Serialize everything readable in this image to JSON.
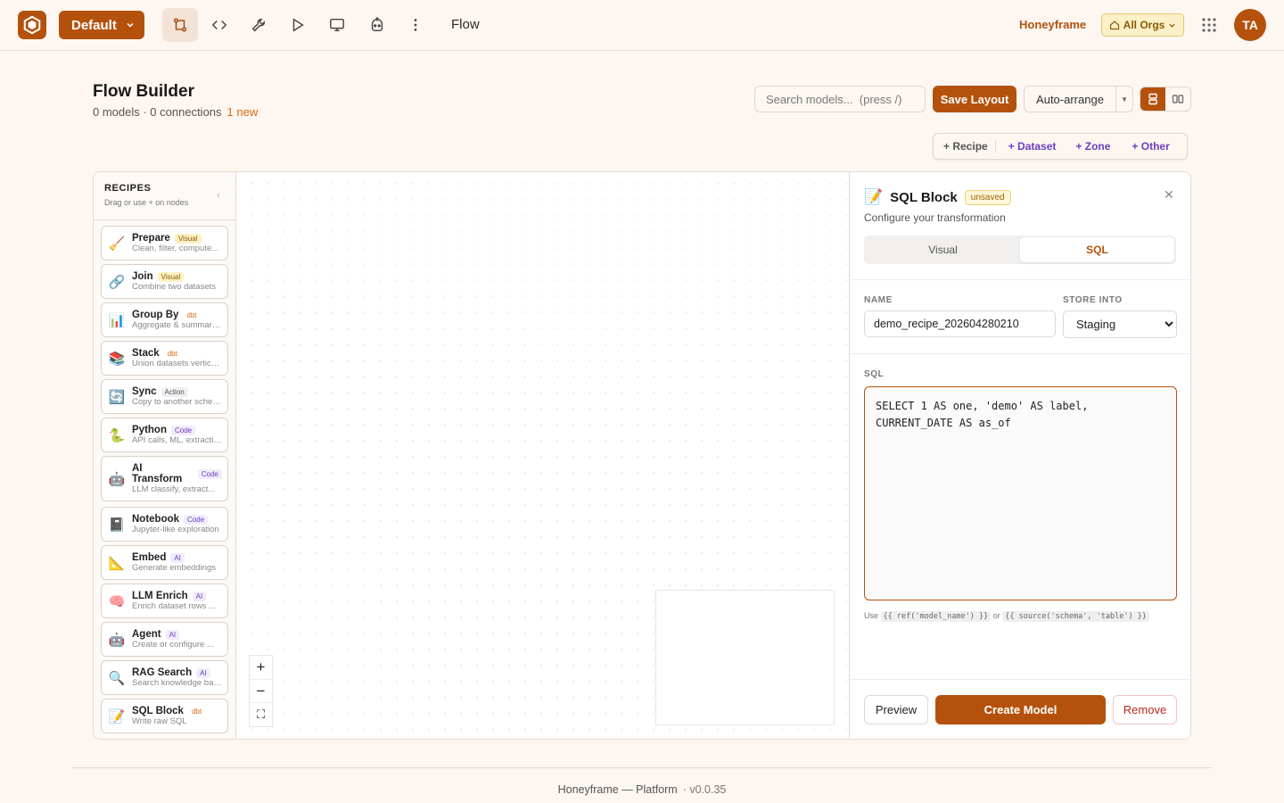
{
  "topbar": {
    "workspace_label": "Default",
    "breadcrumb": "Flow",
    "org_name": "Honeyframe",
    "org_switch_label": "All Orgs",
    "avatar_initials": "TA",
    "icons": [
      "flow-icon",
      "code-icon",
      "wrench-icon",
      "play-icon",
      "monitor-icon",
      "robot-icon",
      "more-vertical-icon"
    ]
  },
  "header": {
    "title": "Flow Builder",
    "stats": "0 models · 0 connections",
    "new_badge": "1 new",
    "search_placeholder": "Search models...  (press /)",
    "save_label": "Save Layout",
    "auto_arrange_label": "Auto-arrange"
  },
  "add_bar": {
    "recipe": "+ Recipe",
    "dataset": "+ Dataset",
    "zone": "+ Zone",
    "other": "+ Other"
  },
  "sidebar": {
    "title": "RECIPES",
    "subtitle": "Drag or use + on nodes",
    "items": [
      {
        "icon": "🧹",
        "name": "Prepare",
        "tag": "Visual",
        "tag_type": "visual",
        "desc": "Clean, filter, compute..."
      },
      {
        "icon": "🔗",
        "name": "Join",
        "tag": "Visual",
        "tag_type": "visual",
        "desc": "Combine two datasets"
      },
      {
        "icon": "📊",
        "name": "Group By",
        "tag": "dbt",
        "tag_type": "dbt",
        "desc": "Aggregate & summarize"
      },
      {
        "icon": "📚",
        "name": "Stack",
        "tag": "dbt",
        "tag_type": "dbt",
        "desc": "Union datasets vertically"
      },
      {
        "icon": "🔄",
        "name": "Sync",
        "tag": "Action",
        "tag_type": "action",
        "desc": "Copy to another schema"
      },
      {
        "icon": "🐍",
        "name": "Python",
        "tag": "Code",
        "tag_type": "code",
        "desc": "API calls, ML, extraction"
      },
      {
        "icon": "🤖",
        "name": "AI Transform",
        "tag": "Code",
        "tag_type": "code",
        "desc": "LLM classify, extract..."
      },
      {
        "icon": "📓",
        "name": "Notebook",
        "tag": "Code",
        "tag_type": "code",
        "desc": "Jupyter-like exploration"
      },
      {
        "icon": "📐",
        "name": "Embed",
        "tag": "AI",
        "tag_type": "ai",
        "desc": "Generate embeddings"
      },
      {
        "icon": "🧠",
        "name": "LLM Enrich",
        "tag": "AI",
        "tag_type": "ai",
        "desc": "Enrich dataset rows ..."
      },
      {
        "icon": "🤖",
        "name": "Agent",
        "tag": "AI",
        "tag_type": "ai",
        "desc": "Create or configure ..."
      },
      {
        "icon": "🔍",
        "name": "RAG Search",
        "tag": "AI",
        "tag_type": "ai",
        "desc": "Search knowledge base"
      },
      {
        "icon": "📝",
        "name": "SQL Block",
        "tag": "dbt",
        "tag_type": "dbt",
        "desc": "Write raw SQL"
      }
    ]
  },
  "canvas": {
    "zoom_in": "+",
    "zoom_out": "−",
    "fit": "⛶"
  },
  "panel": {
    "icon": "📝",
    "title": "SQL Block",
    "status": "unsaved",
    "subtitle": "Configure your transformation",
    "tab_visual": "Visual",
    "tab_sql": "SQL",
    "name_label": "NAME",
    "name_value": "demo_recipe_202604280210",
    "store_label": "STORE INTO",
    "store_value": "Staging",
    "sql_label": "SQL",
    "sql_value": "SELECT 1 AS one, 'demo' AS label,\nCURRENT_DATE AS as_of",
    "hint_use": "Use",
    "hint_ref": "{{ ref('model_name') }}",
    "hint_or": "or",
    "hint_source": "{{ source('schema', 'table') }}",
    "preview_label": "Preview",
    "create_label": "Create Model",
    "remove_label": "Remove"
  },
  "footer": {
    "brand": "Honeyframe — Platform",
    "version": "· v0.0.35"
  },
  "colors": {
    "accent": "#b4520d",
    "background": "#fdf6f1",
    "danger": "#c0261b"
  }
}
